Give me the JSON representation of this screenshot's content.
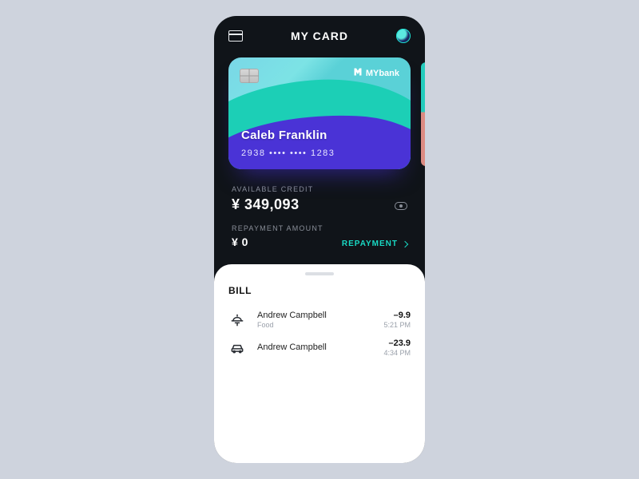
{
  "header": {
    "title": "MY CARD"
  },
  "card": {
    "bank": "MYbank",
    "holder": "Caleb Franklin",
    "number": "2938  ••••  ••••  1283"
  },
  "credit": {
    "label": "AVAILABLE CREDIT",
    "amount": "¥ 349,093"
  },
  "repayment": {
    "label": "REPAYMENT AMOUNT",
    "amount": "¥ 0",
    "action": "REPAYMENT"
  },
  "bill": {
    "title": "BILL",
    "items": [
      {
        "name": "Andrew Campbell",
        "category": "Food",
        "amount": "–9.9",
        "time": "5:21 PM"
      },
      {
        "name": "Andrew Campbell",
        "category": "",
        "amount": "–23.9",
        "time": "4:34 PM"
      }
    ]
  }
}
